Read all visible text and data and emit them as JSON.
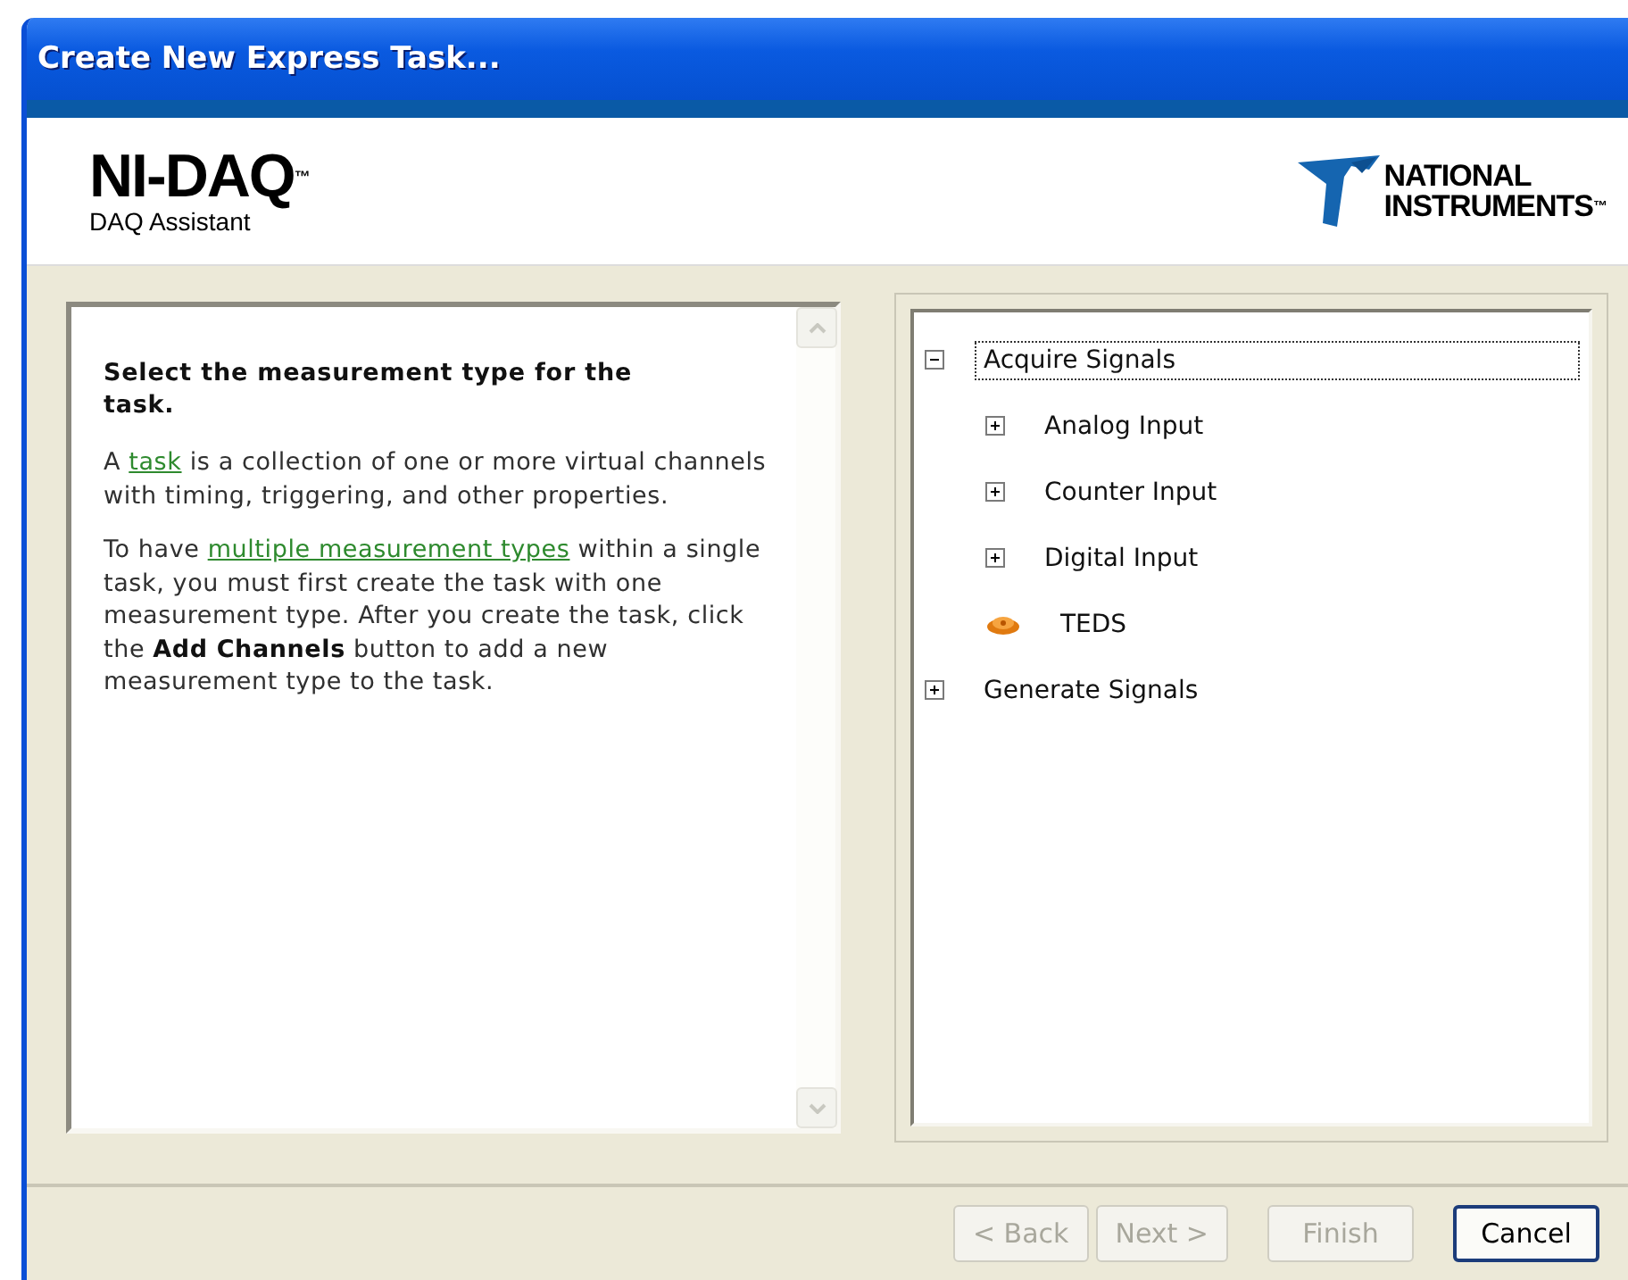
{
  "window": {
    "title": "Create New Express Task..."
  },
  "header": {
    "product": "NI-DAQ$^{™}$",
    "subtitle": "DAQ Assistant",
    "brand_lines": [
      "NATIONAL",
      "INSTRUMENTS$^{™}$"
    ]
  },
  "help": {
    "heading": "Select the measurement type for the task.",
    "paragraphs": [
      [
        {
          "kind": "text",
          "text": "A "
        },
        {
          "kind": "link",
          "text": "task"
        },
        {
          "kind": "text",
          "text": " is a collection of one or more virtual channels with timing, triggering, and other properties."
        }
      ],
      [
        {
          "kind": "text",
          "text": "To have "
        },
        {
          "kind": "link",
          "text": "multiple measurement types"
        },
        {
          "kind": "text",
          "text": " within a single task, you must first create the task with one measurement type. After you create the task, click the **Add Channels** button to add a new measurement type to the task."
        }
      ]
    ]
  },
  "tree": [
    {
      "label": "Acquire Signals",
      "kind": "node",
      "expanded": true,
      "selected": true,
      "children": [
        {
          "label": "Analog Input",
          "kind": "node",
          "expanded": false,
          "selected": false
        },
        {
          "label": "Counter Input",
          "kind": "node",
          "expanded": false,
          "selected": false
        },
        {
          "label": "Digital Input",
          "kind": "node",
          "expanded": false,
          "selected": false
        },
        {
          "label": "TEDS",
          "kind": "leaf",
          "selected": false
        }
      ]
    },
    {
      "label": "Generate Signals",
      "kind": "node",
      "expanded": false,
      "selected": false
    }
  ],
  "buttons": [
    {
      "label": "< Back",
      "disabled": true,
      "default": false
    },
    {
      "label": "Next >",
      "disabled": true,
      "default": false
    },
    {
      "label": "Finish",
      "disabled": true,
      "default": false
    },
    {
      "label": "Cancel",
      "disabled": false,
      "default": true
    }
  ]
}
